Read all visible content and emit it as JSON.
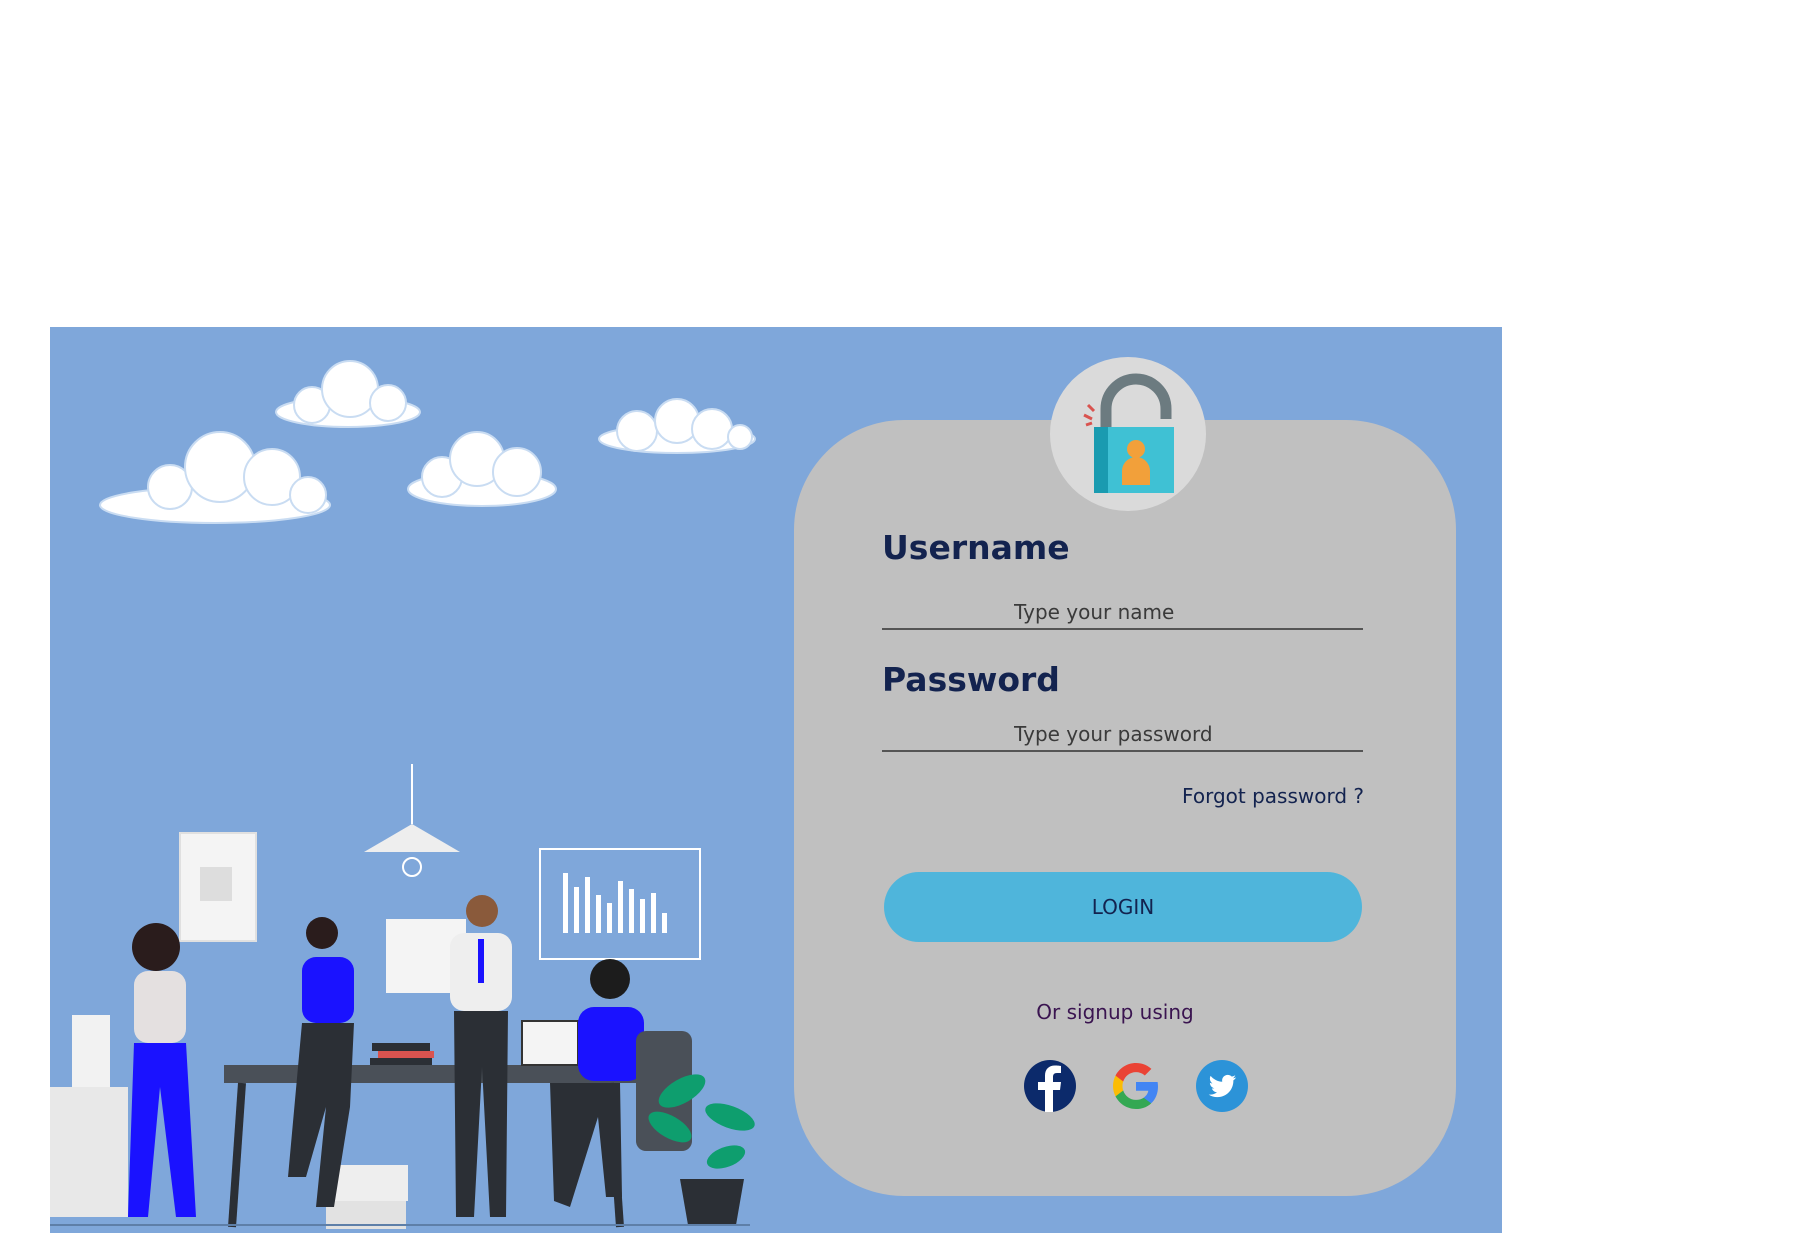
{
  "login_form": {
    "username_label": "Username",
    "username_placeholder": "Type your name",
    "password_label": "Password",
    "password_placeholder": "Type your password",
    "forgot_password": "Forgot password ?",
    "login_button": "LOGIN",
    "signup_text": "Or signup using"
  },
  "social": [
    {
      "icon": "facebook-icon",
      "color": "#0c2a6b"
    },
    {
      "icon": "google-icon"
    },
    {
      "icon": "twitter-icon",
      "color": "#2c93d8"
    }
  ],
  "colors": {
    "panel_background": "#7fa7da",
    "card_background": "#c0c0c0",
    "login_button": "#4fb5db",
    "label_text": "#13234f"
  }
}
